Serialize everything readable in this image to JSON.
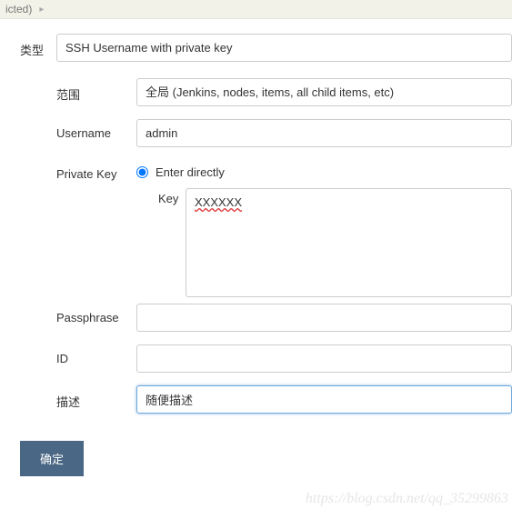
{
  "breadcrumb": {
    "text": "icted)"
  },
  "type": {
    "label": "类型",
    "value": "SSH Username with private key"
  },
  "scope": {
    "label": "范围",
    "value": "全局 (Jenkins, nodes, items, all child items, etc)"
  },
  "username": {
    "label": "Username",
    "value": "admin"
  },
  "privateKey": {
    "label": "Private Key",
    "radioLabel": "Enter directly",
    "keyLabel": "Key",
    "keyValue": "XXXXXX"
  },
  "passphrase": {
    "label": "Passphrase",
    "value": ""
  },
  "id": {
    "label": "ID",
    "value": ""
  },
  "description": {
    "label": "描述",
    "value": "随便描述"
  },
  "submit": {
    "label": "确定"
  },
  "watermark": "https://blog.csdn.net/qq_35299863"
}
